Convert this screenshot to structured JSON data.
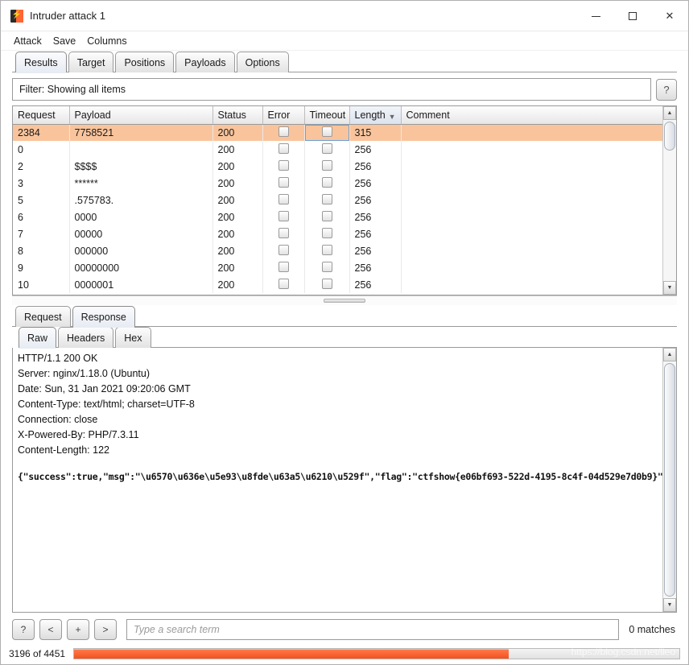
{
  "window": {
    "title": "Intruder attack 1",
    "icon": "burp-suite-icon",
    "minimize_label": "─",
    "maximize_label": "□",
    "close_label": "✕"
  },
  "menubar": {
    "items": [
      "Attack",
      "Save",
      "Columns"
    ]
  },
  "tabs": {
    "items": [
      "Results",
      "Target",
      "Positions",
      "Payloads",
      "Options"
    ],
    "active": "Results"
  },
  "filter": {
    "text": "Filter: Showing all items",
    "help_label": "?"
  },
  "results_table": {
    "columns": [
      "Request",
      "Payload",
      "Status",
      "Error",
      "Timeout",
      "Length",
      "Comment"
    ],
    "sorted_column": "Length",
    "sort_indicator": "▼",
    "rows": [
      {
        "request": "2384",
        "payload": "7758521",
        "status": "200",
        "error": false,
        "timeout": false,
        "length": "315",
        "comment": "",
        "selected": true
      },
      {
        "request": "0",
        "payload": "",
        "status": "200",
        "error": false,
        "timeout": false,
        "length": "256",
        "comment": "",
        "selected": false
      },
      {
        "request": "2",
        "payload": "$$$$",
        "status": "200",
        "error": false,
        "timeout": false,
        "length": "256",
        "comment": "",
        "selected": false
      },
      {
        "request": "3",
        "payload": "******",
        "status": "200",
        "error": false,
        "timeout": false,
        "length": "256",
        "comment": "",
        "selected": false
      },
      {
        "request": "5",
        "payload": ".575783.",
        "status": "200",
        "error": false,
        "timeout": false,
        "length": "256",
        "comment": "",
        "selected": false
      },
      {
        "request": "6",
        "payload": "0000",
        "status": "200",
        "error": false,
        "timeout": false,
        "length": "256",
        "comment": "",
        "selected": false
      },
      {
        "request": "7",
        "payload": "00000",
        "status": "200",
        "error": false,
        "timeout": false,
        "length": "256",
        "comment": "",
        "selected": false
      },
      {
        "request": "8",
        "payload": "000000",
        "status": "200",
        "error": false,
        "timeout": false,
        "length": "256",
        "comment": "",
        "selected": false
      },
      {
        "request": "9",
        "payload": "00000000",
        "status": "200",
        "error": false,
        "timeout": false,
        "length": "256",
        "comment": "",
        "selected": false
      },
      {
        "request": "10",
        "payload": "0000001",
        "status": "200",
        "error": false,
        "timeout": false,
        "length": "256",
        "comment": "",
        "selected": false
      }
    ]
  },
  "message_tabs": {
    "items": [
      "Request",
      "Response"
    ],
    "active": "Response"
  },
  "view_tabs": {
    "items": [
      "Raw",
      "Headers",
      "Hex"
    ],
    "active": "Raw"
  },
  "response": {
    "headers": [
      "HTTP/1.1 200 OK",
      "Server: nginx/1.18.0 (Ubuntu)",
      "Date: Sun, 31 Jan 2021 09:20:06 GMT",
      "Content-Type: text/html; charset=UTF-8",
      "Connection: close",
      "X-Powered-By: PHP/7.3.11",
      "Content-Length: 122"
    ],
    "body": "{\"success\":true,\"msg\":\"\\u6570\\u636e\\u5e93\\u8fde\\u63a5\\u6210\\u529f\",\"flag\":\"ctfshow{e06bf693-522d-4195-8c4f-04d529e7d0b9}\"}"
  },
  "search": {
    "help_label": "?",
    "prev_label": "<",
    "add_label": "+",
    "next_label": ">",
    "placeholder": "Type a search term",
    "value": "",
    "matches": "0 matches"
  },
  "status": {
    "progress_text": "3196 of 4451",
    "progress_percent": 71.8,
    "watermark": "https://blog.csdn.net/lleo"
  },
  "colors": {
    "selected_row": "#f9c49c",
    "progress_fill": "#f4511e",
    "accent": "#ff6633"
  }
}
